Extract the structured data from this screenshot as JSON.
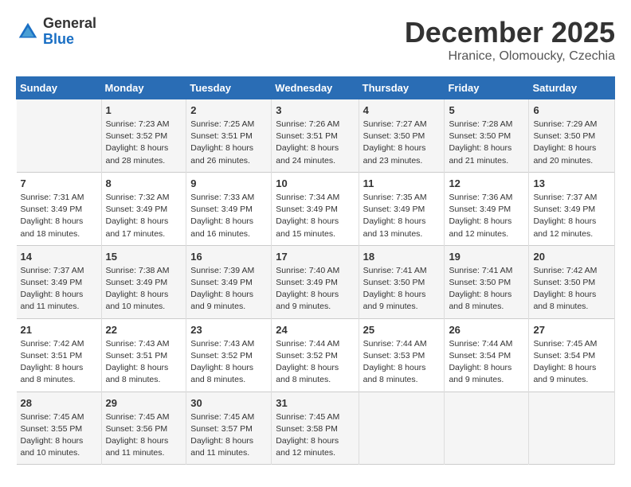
{
  "logo": {
    "general": "General",
    "blue": "Blue"
  },
  "title": "December 2025",
  "subtitle": "Hranice, Olomoucky, Czechia",
  "days_of_week": [
    "Sunday",
    "Monday",
    "Tuesday",
    "Wednesday",
    "Thursday",
    "Friday",
    "Saturday"
  ],
  "weeks": [
    [
      {
        "day": "",
        "info": ""
      },
      {
        "day": "1",
        "info": "Sunrise: 7:23 AM\nSunset: 3:52 PM\nDaylight: 8 hours\nand 28 minutes."
      },
      {
        "day": "2",
        "info": "Sunrise: 7:25 AM\nSunset: 3:51 PM\nDaylight: 8 hours\nand 26 minutes."
      },
      {
        "day": "3",
        "info": "Sunrise: 7:26 AM\nSunset: 3:51 PM\nDaylight: 8 hours\nand 24 minutes."
      },
      {
        "day": "4",
        "info": "Sunrise: 7:27 AM\nSunset: 3:50 PM\nDaylight: 8 hours\nand 23 minutes."
      },
      {
        "day": "5",
        "info": "Sunrise: 7:28 AM\nSunset: 3:50 PM\nDaylight: 8 hours\nand 21 minutes."
      },
      {
        "day": "6",
        "info": "Sunrise: 7:29 AM\nSunset: 3:50 PM\nDaylight: 8 hours\nand 20 minutes."
      }
    ],
    [
      {
        "day": "7",
        "info": "Sunrise: 7:31 AM\nSunset: 3:49 PM\nDaylight: 8 hours\nand 18 minutes."
      },
      {
        "day": "8",
        "info": "Sunrise: 7:32 AM\nSunset: 3:49 PM\nDaylight: 8 hours\nand 17 minutes."
      },
      {
        "day": "9",
        "info": "Sunrise: 7:33 AM\nSunset: 3:49 PM\nDaylight: 8 hours\nand 16 minutes."
      },
      {
        "day": "10",
        "info": "Sunrise: 7:34 AM\nSunset: 3:49 PM\nDaylight: 8 hours\nand 15 minutes."
      },
      {
        "day": "11",
        "info": "Sunrise: 7:35 AM\nSunset: 3:49 PM\nDaylight: 8 hours\nand 13 minutes."
      },
      {
        "day": "12",
        "info": "Sunrise: 7:36 AM\nSunset: 3:49 PM\nDaylight: 8 hours\nand 12 minutes."
      },
      {
        "day": "13",
        "info": "Sunrise: 7:37 AM\nSunset: 3:49 PM\nDaylight: 8 hours\nand 12 minutes."
      }
    ],
    [
      {
        "day": "14",
        "info": "Sunrise: 7:37 AM\nSunset: 3:49 PM\nDaylight: 8 hours\nand 11 minutes."
      },
      {
        "day": "15",
        "info": "Sunrise: 7:38 AM\nSunset: 3:49 PM\nDaylight: 8 hours\nand 10 minutes."
      },
      {
        "day": "16",
        "info": "Sunrise: 7:39 AM\nSunset: 3:49 PM\nDaylight: 8 hours\nand 9 minutes."
      },
      {
        "day": "17",
        "info": "Sunrise: 7:40 AM\nSunset: 3:49 PM\nDaylight: 8 hours\nand 9 minutes."
      },
      {
        "day": "18",
        "info": "Sunrise: 7:41 AM\nSunset: 3:50 PM\nDaylight: 8 hours\nand 9 minutes."
      },
      {
        "day": "19",
        "info": "Sunrise: 7:41 AM\nSunset: 3:50 PM\nDaylight: 8 hours\nand 8 minutes."
      },
      {
        "day": "20",
        "info": "Sunrise: 7:42 AM\nSunset: 3:50 PM\nDaylight: 8 hours\nand 8 minutes."
      }
    ],
    [
      {
        "day": "21",
        "info": "Sunrise: 7:42 AM\nSunset: 3:51 PM\nDaylight: 8 hours\nand 8 minutes."
      },
      {
        "day": "22",
        "info": "Sunrise: 7:43 AM\nSunset: 3:51 PM\nDaylight: 8 hours\nand 8 minutes."
      },
      {
        "day": "23",
        "info": "Sunrise: 7:43 AM\nSunset: 3:52 PM\nDaylight: 8 hours\nand 8 minutes."
      },
      {
        "day": "24",
        "info": "Sunrise: 7:44 AM\nSunset: 3:52 PM\nDaylight: 8 hours\nand 8 minutes."
      },
      {
        "day": "25",
        "info": "Sunrise: 7:44 AM\nSunset: 3:53 PM\nDaylight: 8 hours\nand 8 minutes."
      },
      {
        "day": "26",
        "info": "Sunrise: 7:44 AM\nSunset: 3:54 PM\nDaylight: 8 hours\nand 9 minutes."
      },
      {
        "day": "27",
        "info": "Sunrise: 7:45 AM\nSunset: 3:54 PM\nDaylight: 8 hours\nand 9 minutes."
      }
    ],
    [
      {
        "day": "28",
        "info": "Sunrise: 7:45 AM\nSunset: 3:55 PM\nDaylight: 8 hours\nand 10 minutes."
      },
      {
        "day": "29",
        "info": "Sunrise: 7:45 AM\nSunset: 3:56 PM\nDaylight: 8 hours\nand 11 minutes."
      },
      {
        "day": "30",
        "info": "Sunrise: 7:45 AM\nSunset: 3:57 PM\nDaylight: 8 hours\nand 11 minutes."
      },
      {
        "day": "31",
        "info": "Sunrise: 7:45 AM\nSunset: 3:58 PM\nDaylight: 8 hours\nand 12 minutes."
      },
      {
        "day": "",
        "info": ""
      },
      {
        "day": "",
        "info": ""
      },
      {
        "day": "",
        "info": ""
      }
    ]
  ]
}
